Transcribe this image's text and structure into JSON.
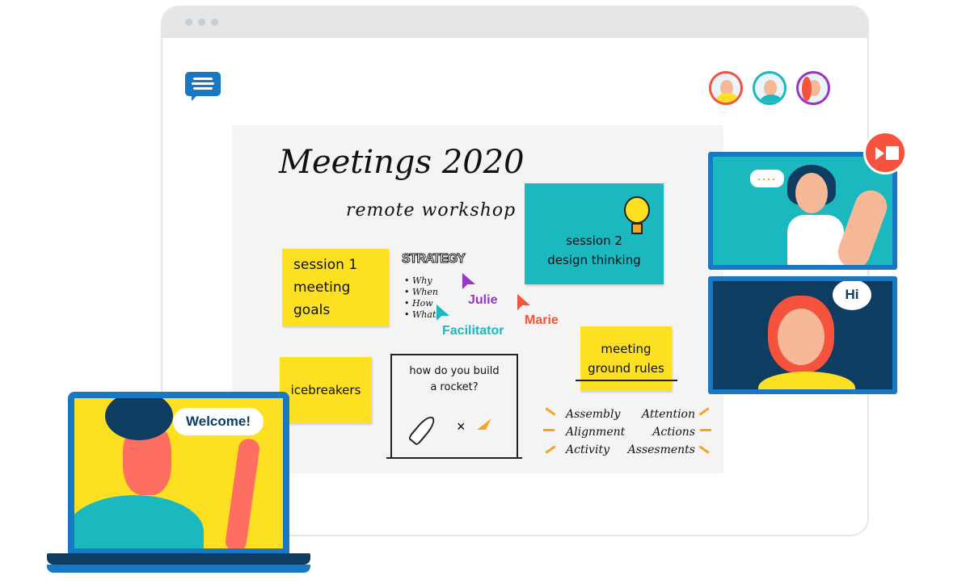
{
  "board": {
    "title": "Meetings 2020",
    "subtitle": "remote workshop",
    "notes": {
      "session1": [
        "session 1",
        "meeting goals"
      ],
      "session2": [
        "session 2",
        "design thinking"
      ],
      "icebreakers": "icebreakers",
      "ground_rules": [
        "meeting",
        "ground rules"
      ]
    },
    "strategy": {
      "heading": "STRATEGY",
      "items": [
        "Why",
        "When",
        "How",
        "What"
      ]
    },
    "rocket": [
      "how do you build",
      "a rocket?"
    ],
    "words": [
      [
        "Assembly",
        "Attention"
      ],
      [
        "Alignment",
        "Actions"
      ],
      [
        "Activity",
        "Assesments"
      ]
    ]
  },
  "cursors": [
    {
      "name": "Julie",
      "color": "#9b35c6"
    },
    {
      "name": "Marie",
      "color": "#f5533d"
    },
    {
      "name": "Facilitator",
      "color": "#1bb8c0"
    }
  ],
  "participants": [
    "participant-1",
    "participant-2",
    "participant-3"
  ],
  "video": {
    "bubble_top": "....",
    "bubble_bottom": "Hi",
    "record_icon": "record-stop-icon"
  },
  "laptop": {
    "greeting": "Welcome!"
  },
  "colors": {
    "blue": "#1878c4",
    "yellow": "#fde021",
    "teal": "#1bb8c0",
    "navy": "#0f3d62",
    "red": "#f5533d"
  }
}
